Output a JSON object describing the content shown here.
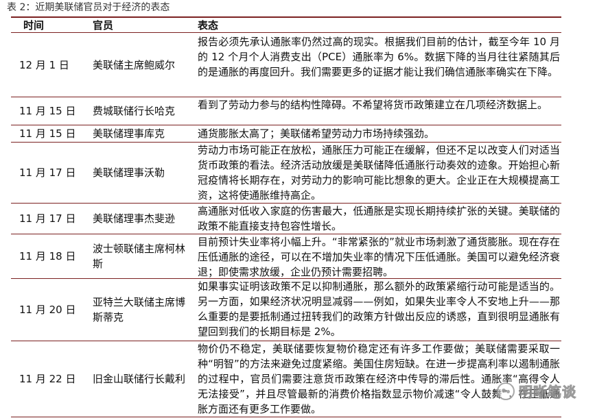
{
  "caption": "表 2：近期美联储官员对于经济的表态",
  "headers": {
    "date": "时间",
    "official": "官员",
    "remark": "表态"
  },
  "rows": [
    {
      "date": "12 月 1 日",
      "official": "美联储主席鲍威尔",
      "remark": "报告必须先承认通胀率仍然过高的现实。根据我们目前的估计，截至今年 10 月的 12 个月个人消费支出（PCE）通胀率为 6%。数据下降的当月往往紧随其后的是通胀的再度回升。我们需要更多的证据才能让我们确信通胀率确实在下降。"
    },
    {
      "date": "11 月 15 日",
      "official": "费城联储行长哈克",
      "remark": "看到了劳动力参与的结构性障碍。不希望将货币政策建立在几项经济数据上。"
    },
    {
      "date": "11 月 15 日",
      "official": "美联储理事库克",
      "remark": "通货膨胀太高了；美联储希望劳动力市场持续强劲。"
    },
    {
      "date": "11 月 17 日",
      "official": "美联储理事沃勒",
      "remark": "劳动力市场可能正在放松，通胀压力可能正在缓解，但还不足以改变人们对适当货币政策的看法。经济活动放缓是美联储降低通胀行动奏效的迹象。开始担心新冠疫情将长期存在，对劳动力的影响可能比想象的更大。企业正在大规模提高工资，这将使通胀维持高企。"
    },
    {
      "date": "11 月 17 日",
      "official": "美联储理事杰斐逊",
      "remark": "高通胀对低收入家庭的伤害最大，低通胀是实现长期持续扩张的关键。美联储的政策不能直接支持包容性增长。"
    },
    {
      "date": "11 月 18 日",
      "official": "波士顿联储主席柯林斯",
      "remark": "目前预计失业率将小幅上升。“非常紧张的”就业市场刺激了通货膨胀。现在存在压低通胀的途径，可以在不增加失业率的情况下压低通胀。美国可以避免经济衰退；即使需求放缓，企业仍预计需要招聘。"
    },
    {
      "date": "11 月 20 日",
      "official": "亚特兰大联储主席博斯蒂克",
      "remark": "如果事实证明该政策不足以抑制通胀，那么额外的政策紧缩行动可能是适当的。另一方面，如果经济状况明显减弱——例如，如果失业率令人不安地上升——那么重要的是要抵制通过扭转我们的政策方针做出反应的诱惑，直到很明显通胀有望回到我们的长期目标是 2%。"
    },
    {
      "date": "11 月 22 日",
      "official": "旧金山联储行长戴利",
      "remark": "物价仍不稳定，美联储要恢复物价稳定还有许多工作要做；美联储需要采取一种“明智”的方法来避免过度紧缩。美国住房短缺。在进一步提高利率以遏制通胀的过程中，官员们需要注意货币政策在经济中传导的滞后性。通胀率“高得令人无法接受”，并且尽管最新的消费价格指数显示物价减速“令人鼓舞”，在压低通胀方面还有更多工作要做。"
    }
  ],
  "watermark": {
    "icon": "wechat-icon",
    "text": "明晰笔谈"
  }
}
